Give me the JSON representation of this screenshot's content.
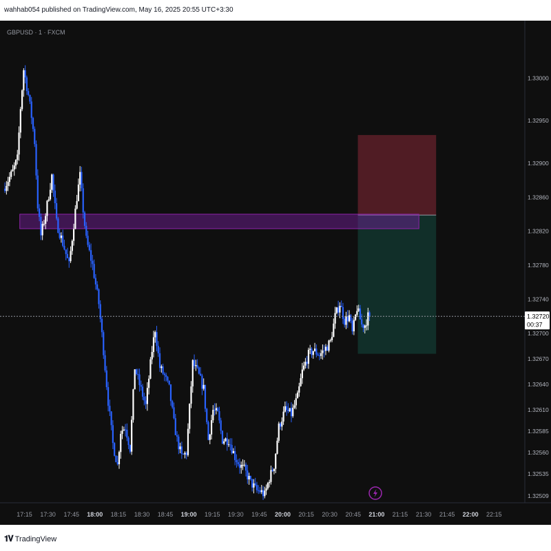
{
  "header": {
    "published_text": "wahhab054 published on TradingView.com, May 16, 2025 20:55 UTC+3:30"
  },
  "footer": {
    "brand": "TradingView",
    "logo_icon": "tradingview-logo-icon"
  },
  "colors": {
    "background": "#0f0f0f",
    "up_candle": "#ffffff",
    "down_candle": "#2962ff",
    "zone": "#7b1fa2",
    "stop_zone": "#5c1f28",
    "target_zone": "#12332c",
    "last_price_bg": "#ffffff",
    "alert_icon": "#9c27b0"
  },
  "chart_data": {
    "type": "candlestick",
    "symbol_label": "GBPUSD · 1 · FXCM",
    "y_axis": {
      "ticks": [
        "1.33000",
        "1.32950",
        "1.32900",
        "1.32860",
        "1.32820",
        "1.32780",
        "1.32740",
        "1.32700",
        "1.32670",
        "1.32640",
        "1.32610",
        "1.32585",
        "1.32560",
        "1.32535",
        "1.32509"
      ],
      "range": [
        1.32505,
        1.33035
      ]
    },
    "x_axis": {
      "ticks": [
        "17:15",
        "17:30",
        "17:45",
        "18:00",
        "18:15",
        "18:30",
        "18:45",
        "19:00",
        "19:15",
        "19:30",
        "19:45",
        "20:00",
        "20:15",
        "20:30",
        "20:45",
        "21:00",
        "21:15",
        "21:30",
        "21:45",
        "22:00",
        "22:15"
      ],
      "bold_ticks": [
        "18:00",
        "19:00",
        "20:00",
        "21:00",
        "22:00"
      ],
      "range": [
        "17:02",
        "22:25"
      ]
    },
    "last_price": {
      "value": "1.32720",
      "countdown": "00:37"
    },
    "last_price_value": 1.3272,
    "zone": {
      "from_time": "17:12",
      "to_time": "21:27",
      "top": 1.3284,
      "bottom": 1.32823
    },
    "position": {
      "from_time": "20:48",
      "to_time": "21:38",
      "entry": 1.32839,
      "stop": 1.32933,
      "target": 1.32676
    },
    "price_path": [
      [
        "17:02",
        1.3287
      ],
      [
        "17:08",
        1.3289
      ],
      [
        "17:11",
        1.32905
      ],
      [
        "17:13",
        1.32965
      ],
      [
        "17:15",
        1.3301
      ],
      [
        "17:18",
        1.3298
      ],
      [
        "17:20",
        1.32955
      ],
      [
        "17:22",
        1.32925
      ],
      [
        "17:24",
        1.3285
      ],
      [
        "17:26",
        1.32815
      ],
      [
        "17:29",
        1.3284
      ],
      [
        "17:33",
        1.32885
      ],
      [
        "17:36",
        1.3283
      ],
      [
        "17:41",
        1.328
      ],
      [
        "17:44",
        1.3278
      ],
      [
        "17:49",
        1.3286
      ],
      [
        "17:51",
        1.32885
      ],
      [
        "17:53",
        1.32845
      ],
      [
        "17:55",
        1.3281
      ],
      [
        "17:59",
        1.3278
      ],
      [
        "18:03",
        1.32735
      ],
      [
        "18:06",
        1.3268
      ],
      [
        "18:09",
        1.3262
      ],
      [
        "18:12",
        1.3257
      ],
      [
        "18:15",
        1.32545
      ],
      [
        "18:17",
        1.32585
      ],
      [
        "18:20",
        1.3259
      ],
      [
        "18:23",
        1.32565
      ],
      [
        "18:26",
        1.3266
      ],
      [
        "18:29",
        1.3264
      ],
      [
        "18:33",
        1.32615
      ],
      [
        "18:37",
        1.3268
      ],
      [
        "18:39",
        1.32705
      ],
      [
        "18:42",
        1.3266
      ],
      [
        "18:45",
        1.3265
      ],
      [
        "18:48",
        1.32635
      ],
      [
        "18:51",
        1.32595
      ],
      [
        "18:53",
        1.32575
      ],
      [
        "18:56",
        1.32555
      ],
      [
        "18:59",
        1.3256
      ],
      [
        "19:03",
        1.32665
      ],
      [
        "19:06",
        1.32655
      ],
      [
        "19:10",
        1.32635
      ],
      [
        "19:13",
        1.32575
      ],
      [
        "19:16",
        1.3261
      ],
      [
        "19:19",
        1.32605
      ],
      [
        "19:22",
        1.32575
      ],
      [
        "19:26",
        1.32575
      ],
      [
        "19:30",
        1.32555
      ],
      [
        "19:33",
        1.32545
      ],
      [
        "19:36",
        1.3254
      ],
      [
        "19:40",
        1.32525
      ],
      [
        "19:44",
        1.32515
      ],
      [
        "19:46",
        1.32515
      ],
      [
        "19:49",
        1.3251
      ],
      [
        "19:52",
        1.3253
      ],
      [
        "19:55",
        1.32545
      ],
      [
        "19:58",
        1.3259
      ],
      [
        "20:02",
        1.3261
      ],
      [
        "20:06",
        1.32605
      ],
      [
        "20:10",
        1.32625
      ],
      [
        "20:13",
        1.32655
      ],
      [
        "20:17",
        1.32675
      ],
      [
        "20:20",
        1.3268
      ],
      [
        "20:24",
        1.32675
      ],
      [
        "20:27",
        1.3268
      ],
      [
        "20:31",
        1.3269
      ],
      [
        "20:34",
        1.3272
      ],
      [
        "20:37",
        1.32735
      ],
      [
        "20:40",
        1.32715
      ],
      [
        "20:43",
        1.3272
      ],
      [
        "20:45",
        1.327
      ],
      [
        "20:48",
        1.3273
      ],
      [
        "20:51",
        1.3271
      ],
      [
        "20:53",
        1.3271
      ],
      [
        "20:55",
        1.3272
      ]
    ]
  }
}
